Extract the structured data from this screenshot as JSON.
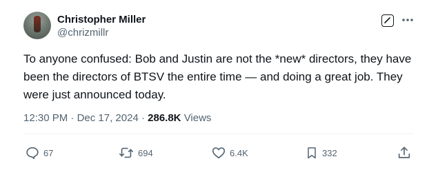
{
  "author": {
    "display_name": "Christopher Miller",
    "handle": "@chrizmillr"
  },
  "tweet": {
    "text": "To anyone confused: Bob and Justin are not the *new* directors, they have been the directors of BTSV the entire time — and doing a great job. They were just announced today.",
    "time": "12:30 PM",
    "separator": "·",
    "date": "Dec 17, 2024",
    "views_count": "286.8K",
    "views_label": "Views"
  },
  "actions": {
    "replies": "67",
    "reposts": "694",
    "likes": "6.4K",
    "bookmarks": "332"
  },
  "icons": {
    "avatar": "profile-photo",
    "edit": "grok-icon",
    "more": "more-icon",
    "reply": "reply-icon",
    "repost": "repost-icon",
    "like": "heart-icon",
    "bookmark": "bookmark-icon",
    "share": "share-icon"
  },
  "colors": {
    "text": "#0f1419",
    "secondary": "#536471"
  }
}
